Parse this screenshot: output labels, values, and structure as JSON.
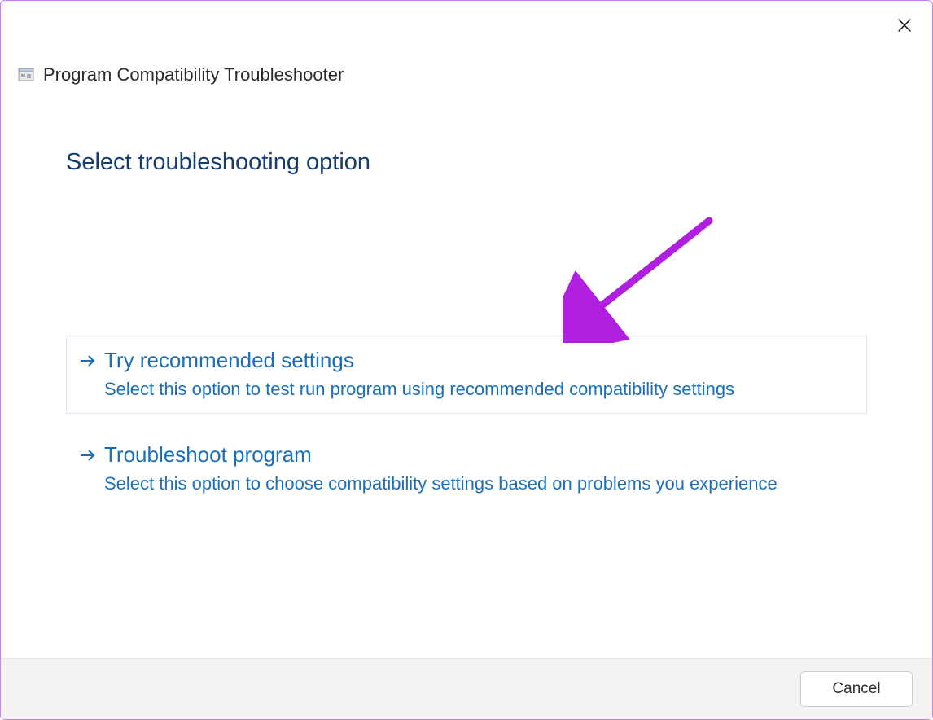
{
  "window": {
    "title": "Program Compatibility Troubleshooter"
  },
  "heading": "Select troubleshooting option",
  "options": [
    {
      "title": "Try recommended settings",
      "description": "Select this option to test run program using recommended compatibility settings",
      "selected": true
    },
    {
      "title": "Troubleshoot program",
      "description": "Select this option to choose compatibility settings based on problems you experience",
      "selected": false
    }
  ],
  "footer": {
    "cancel_label": "Cancel"
  },
  "colors": {
    "heading": "#163C6E",
    "link": "#1b6fb7",
    "annotation": "#b01fe0"
  }
}
